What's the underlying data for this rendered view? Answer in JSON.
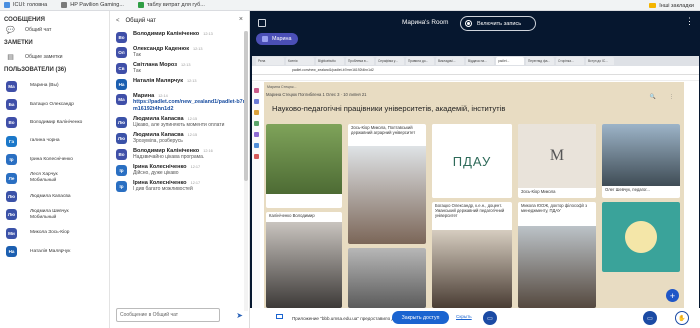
{
  "bookmarks": [
    {
      "label": "ICUI: головна",
      "color": "#4a8fe0"
    },
    {
      "label": "HP Pavilion Gaming...",
      "color": "#7a7a7a"
    },
    {
      "label": "таблу витрат для губ...",
      "color": "#2f9e44"
    }
  ],
  "bookmarks_right": "Інші закладки",
  "left": {
    "messages_title": "СООБЩЕНИЯ",
    "public_chat": "Общий чат",
    "notes_title": "ЗАМЕТКИ",
    "shared_notes": "Общие заметки",
    "users_title": "ПОЛЬЗОВАТЕЛИ (36)",
    "users": [
      {
        "initials": "Ма",
        "name": "Марина (Вы)",
        "color": "#3f4fa8"
      },
      {
        "initials": "Ба",
        "name": "Батацко Олександр",
        "color": "#3f4fa8"
      },
      {
        "initials": "Во",
        "name": "Володимир Калініченко",
        "color": "#3f4fa8"
      },
      {
        "initials": "Га",
        "name": "галина чорна",
        "color": "#1b78c9"
      },
      {
        "initials": "Ір",
        "name": "Ірина Колесніченко",
        "color": "#2a6fc2"
      },
      {
        "initials": "Ле",
        "name": "Леся Харчук\nМобильный",
        "color": "#2a6fc2"
      },
      {
        "initials": "Лю",
        "name": "Людмила Капасва",
        "color": "#3b52a8"
      },
      {
        "initials": "Лю",
        "name": "Людмила Шевчук\nМобильный",
        "color": "#3b52a8"
      },
      {
        "initials": "Ми",
        "name": "Микола Зось-Кіор",
        "color": "#3b52a8"
      },
      {
        "initials": "На",
        "name": "Наталія Малярчук",
        "color": "#1c5fb0"
      }
    ]
  },
  "chat": {
    "back": "<",
    "title": "Общий чат",
    "close": "×",
    "input_placeholder": "Сообщение в Общий чат",
    "messages": [
      {
        "initials": "Во",
        "color": "#3f4fa8",
        "name": "Володимир Калініченко",
        "time": "12:13",
        "text": ""
      },
      {
        "initials": "Ол",
        "color": "#3f4fa8",
        "name": "Олександр Каденюк",
        "time": "12:13",
        "text": "Так"
      },
      {
        "initials": "Св",
        "color": "#3f4fa8",
        "name": "Світлана Мороз",
        "time": "12:13",
        "text": "Так"
      },
      {
        "initials": "На",
        "color": "#1c5fb0",
        "name": "Наталія Малярчук",
        "time": "12:13",
        "text": ""
      },
      {
        "initials": "Ма",
        "color": "#3f4fa8",
        "name": "Марина",
        "time": "12:14",
        "link": "https://padlet.com/new_zealand1/padlet-b7mm16192t4hn1d2"
      },
      {
        "initials": "Лю",
        "color": "#3b52a8",
        "name": "Людмила Капасва",
        "time": "12:15",
        "text": "Цікаво, але зупиняють моменти оплати"
      },
      {
        "initials": "Лю",
        "color": "#3b52a8",
        "name": "Людмила Капасва",
        "time": "12:15",
        "text": "Зрозуміла, розберусь"
      },
      {
        "initials": "Во",
        "color": "#3f4fa8",
        "name": "Володимир Калініченко",
        "time": "12:16",
        "text": "Надзвичайно цікава програма."
      },
      {
        "initials": "Ір",
        "color": "#2a6fc2",
        "name": "Ірина Колесніченко",
        "time": "12:17",
        "text": "Дійсно, дуже цікаво"
      },
      {
        "initials": "Ір",
        "color": "#2a6fc2",
        "name": "Ірина Колесніченко",
        "time": "12:17",
        "text": "І див багато можливостей"
      }
    ]
  },
  "main": {
    "room": "Марина's Room",
    "record": "Включить запись",
    "presenter": "Марина",
    "url": "padlet.com/new_zealand1/padlet-b7mm16192t4hn1d2",
    "tabs": [
      "Рела",
      "Ксенія",
      "Bigbluebutto",
      "Проблема в...",
      "Серафіма у...",
      "Правила до...",
      "Викладачі...",
      "Віддача на...",
      "padlet...",
      "Перегляд фа...",
      "Сторінка...",
      "Вступ до IC..."
    ],
    "padlet": {
      "top": "Марина Стецюк...",
      "breadcrumb": "Марина Стецюк Поглиблена 1 Олес 3 · 10 липня 21",
      "heading": "Науково-педагогічні працівники університетів, академій, інститутів",
      "cards": [
        {
          "text": "Зось-Кіор Микола, Полтавський державний аграрний університет"
        },
        {
          "text": "Калініченко Володимир"
        },
        {
          "text": "ПДАУ"
        },
        {
          "text": "Богацко Олександр, к.е.н., доцент. Уманський державний педагогічний університет"
        },
        {
          "text": "Зось-Кіор Микола"
        },
        {
          "text": "Микола ЮОЖ, доктор філософії з менеджменту, ПДАУ"
        },
        {
          "text": "M"
        },
        {
          "text": "Олег Шевчук, педагог..."
        }
      ]
    }
  },
  "share": {
    "text": "Приложение \"bbb.umsa.edu.ua\" предоставило доступ к окну.",
    "button": "Закрыть доступ",
    "cancel": "Скрыть"
  }
}
